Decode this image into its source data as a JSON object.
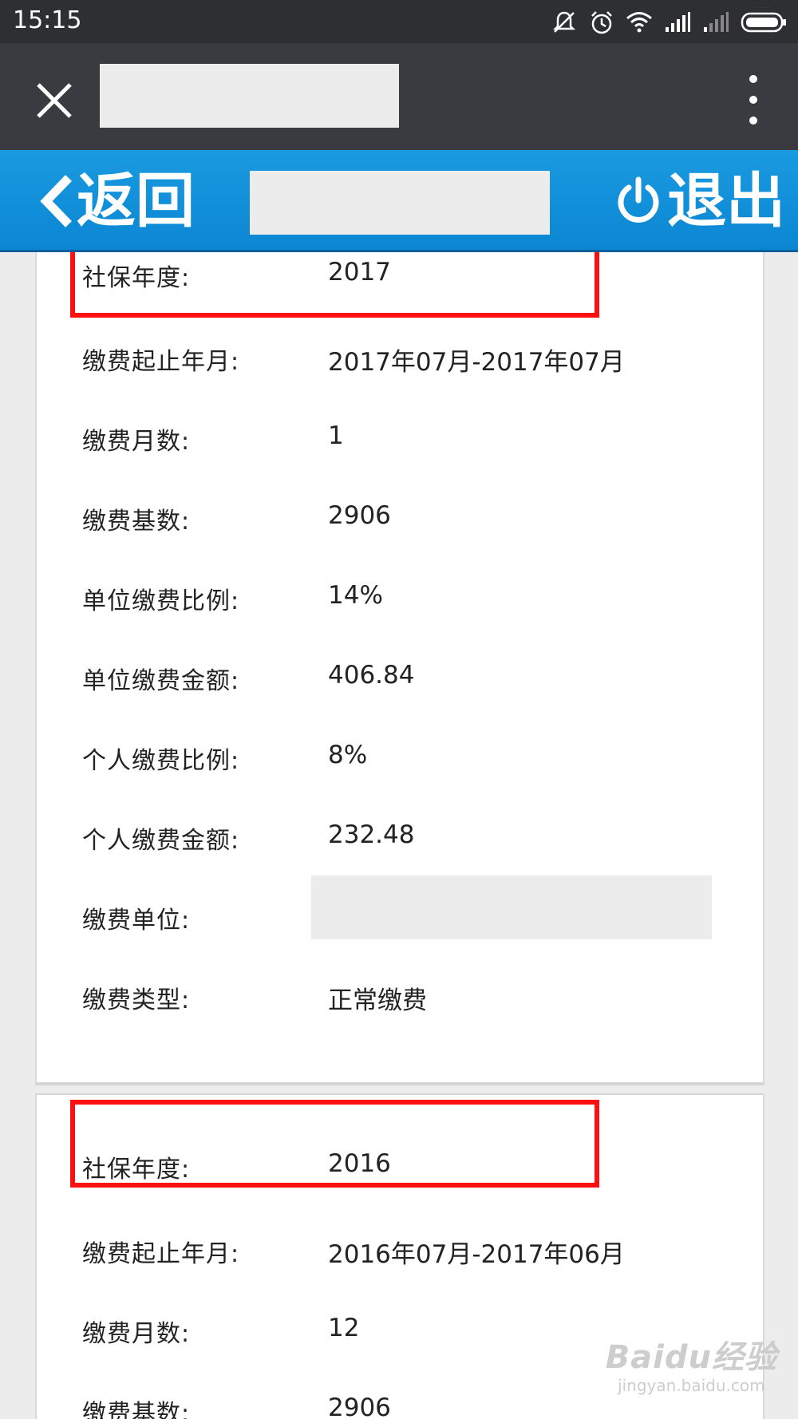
{
  "status_bar": {
    "time": "15:15",
    "icons": [
      "mute-icon",
      "alarm-icon",
      "wifi-icon",
      "signal-icon",
      "signal-weak-icon",
      "battery-icon"
    ]
  },
  "title_bar": {
    "close_icon": "close-icon",
    "menu_icon": "more-vert-icon"
  },
  "header": {
    "back_label": "返回",
    "exit_label": "退出",
    "accent_color": "#0b8ed8"
  },
  "records": [
    {
      "year_label": "社保年度:",
      "year_value": "2017",
      "period_label": "缴费起止年月:",
      "period_value": "2017年07月-2017年07月",
      "months_label": "缴费月数:",
      "months_value": "1",
      "base_label": "缴费基数:",
      "base_value": "2906",
      "unit_ratio_label": "单位缴费比例:",
      "unit_ratio_value": "14%",
      "unit_amount_label": "单位缴费金额:",
      "unit_amount_value": "406.84",
      "personal_ratio_label": "个人缴费比例:",
      "personal_ratio_value": "8%",
      "personal_amount_label": "个人缴费金额:",
      "personal_amount_value": "232.48",
      "employer_label": "缴费单位:",
      "type_label": "缴费类型:",
      "type_value": "正常缴费"
    },
    {
      "year_label": "社保年度:",
      "year_value": "2016",
      "period_label": "缴费起止年月:",
      "period_value": "2016年07月-2017年06月",
      "months_label": "缴费月数:",
      "months_value": "12",
      "base_label": "缴费基数:",
      "base_value": "2906"
    }
  ],
  "highlight_color": "#ff1010",
  "watermark": {
    "logo": "Baidu经验",
    "url": "jingyan.baidu.com"
  }
}
